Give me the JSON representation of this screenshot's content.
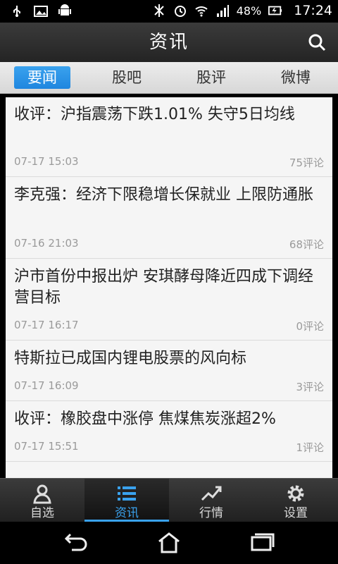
{
  "status_bar": {
    "battery_text": "48%",
    "time": "17:24",
    "icons": [
      "usb-icon",
      "image-icon",
      "android-icon",
      "bluetooth-icon",
      "alarm-icon",
      "wifi-icon",
      "signal-icon",
      "battery-icon"
    ]
  },
  "header": {
    "title": "资讯",
    "search_icon": "search-icon"
  },
  "tabs": [
    {
      "label": "要闻",
      "active": true
    },
    {
      "label": "股吧",
      "active": false
    },
    {
      "label": "股评",
      "active": false
    },
    {
      "label": "微博",
      "active": false
    }
  ],
  "news": [
    {
      "title": "收评：沪指震荡下跌1.01% 失守5日均线",
      "time": "07-17  15:03",
      "comments": "75评论"
    },
    {
      "title": "李克强：经济下限稳增长保就业 上限防通胀",
      "time": "07-16  21:03",
      "comments": "68评论"
    },
    {
      "title": "沪市首份中报出炉 安琪酵母降近四成下调经营目标",
      "time": "07-17  16:17",
      "comments": "0评论"
    },
    {
      "title": "特斯拉已成国内锂电股票的风向标",
      "time": "07-17  16:09",
      "comments": "3评论"
    },
    {
      "title": "收评：橡胶盘中涨停 焦煤焦炭涨超2%",
      "time": "07-17  15:51",
      "comments": "1评论"
    }
  ],
  "bottom_nav": [
    {
      "label": "自选",
      "icon": "person-icon",
      "active": false
    },
    {
      "label": "资讯",
      "icon": "list-icon",
      "active": true
    },
    {
      "label": "行情",
      "icon": "trend-icon",
      "active": false
    },
    {
      "label": "设置",
      "icon": "gear-icon",
      "active": false
    }
  ],
  "system_nav": [
    "back-icon",
    "home-icon",
    "recent-apps-icon"
  ],
  "colors": {
    "accent": "#3aa2ee",
    "header_bg": "#2f2f2f",
    "tab_bg": "#e3e3e3"
  }
}
